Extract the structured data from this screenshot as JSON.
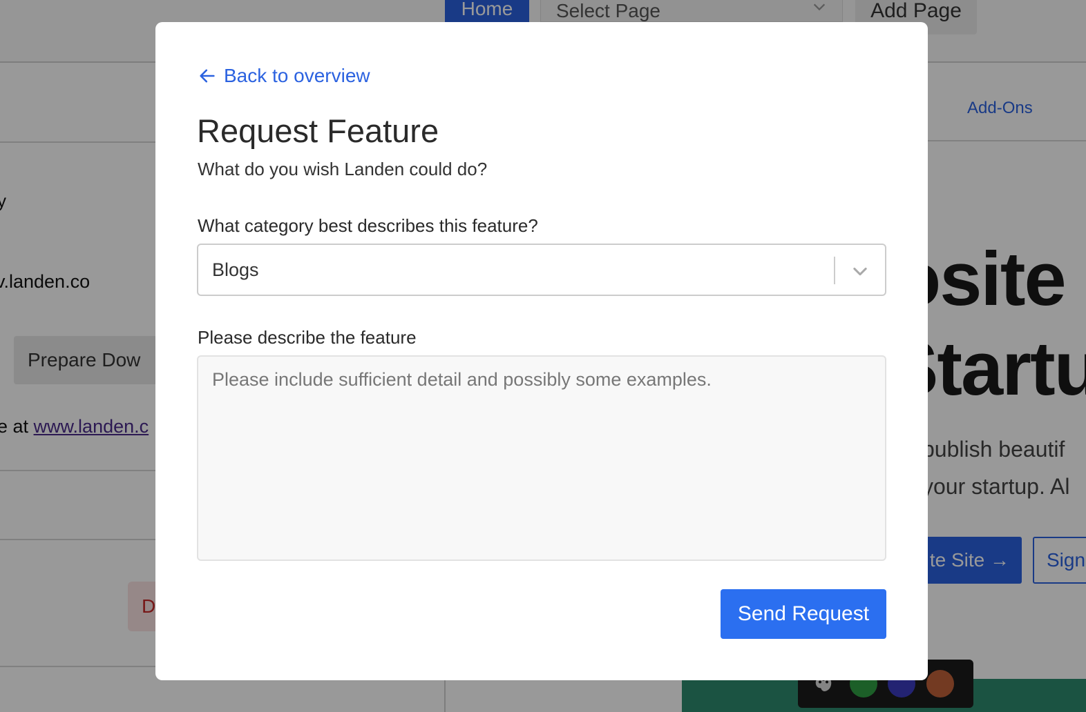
{
  "background": {
    "topbar": {
      "home_label": "Home",
      "select_page_placeholder": "Select Page",
      "add_page_label": "Add Page"
    },
    "left_panel": {
      "fragment_text": "y",
      "url_fragment": "v.landen.co",
      "prepare_button_label": "Prepare Dow",
      "live_prefix": "e at ",
      "live_link": "www.landen.c",
      "danger_fragment": "D"
    },
    "right_panel": {
      "addons_label": "Add-Ons",
      "hero_line1": "osite",
      "hero_line2": "Startu",
      "hero_sub1": "publish beautif",
      "hero_sub2": "your startup. Al",
      "create_button_label": "te Site →",
      "signin_button_label": "Sign"
    },
    "palette_colors": [
      "#2f9e44",
      "#3b3bbf",
      "#c0623a"
    ]
  },
  "modal": {
    "back_link_label": "Back to overview",
    "title": "Request Feature",
    "subtitle": "What do you wish Landen could do?",
    "category": {
      "label": "What category best describes this feature?",
      "selected_value": "Blogs"
    },
    "description": {
      "label": "Please describe the feature",
      "placeholder": "Please include sufficient detail and possibly some examples."
    },
    "send_button_label": "Send Request"
  },
  "colors": {
    "accent": "#2b6ff0",
    "overlay": "rgba(0,0,0,0.40)"
  }
}
